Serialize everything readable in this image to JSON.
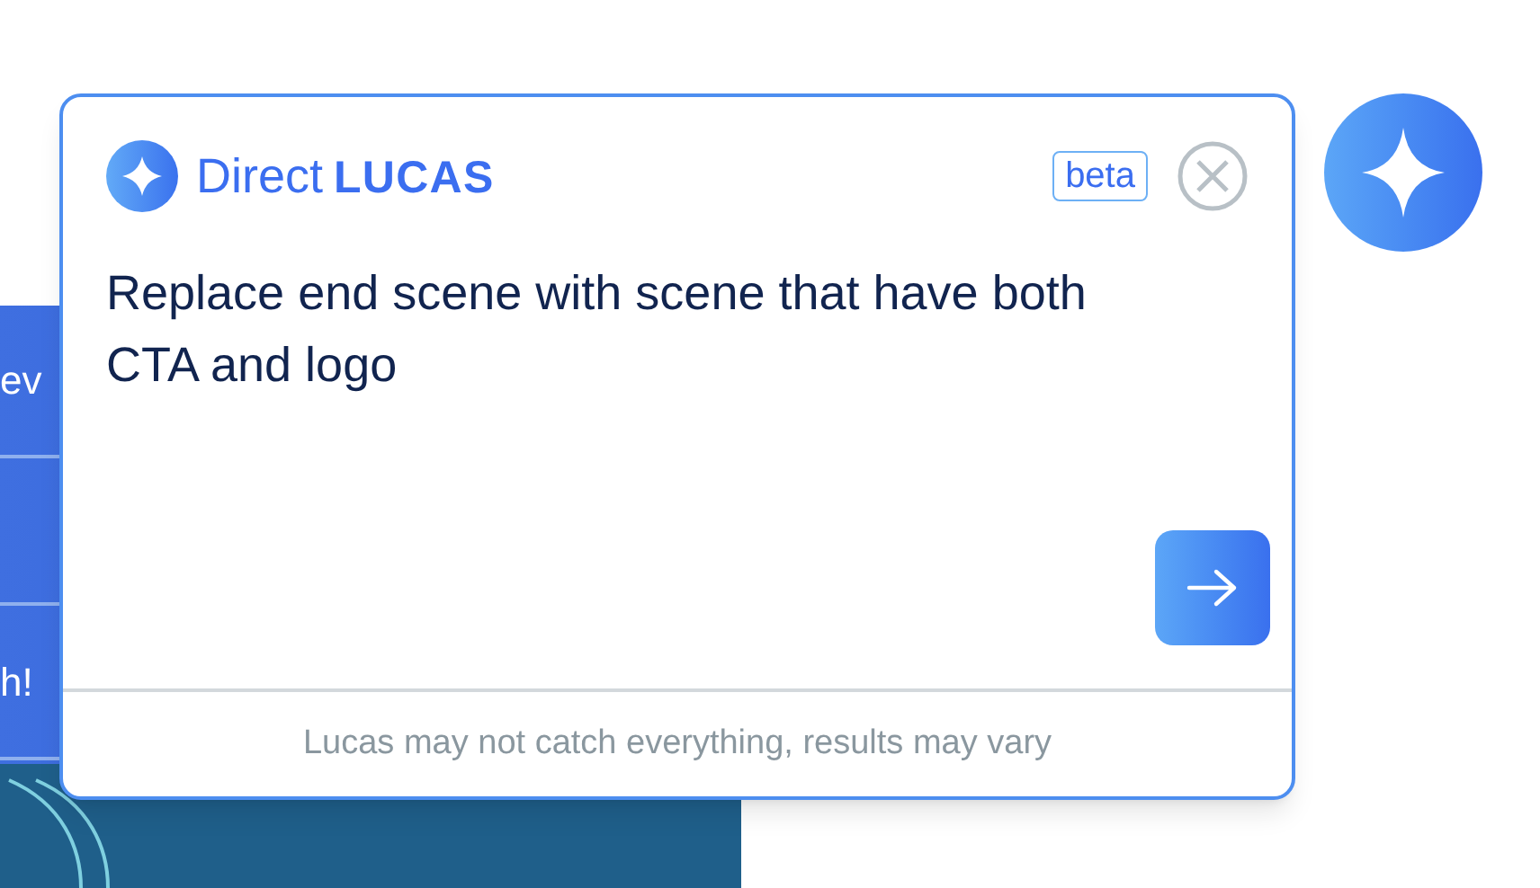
{
  "background_panel": {
    "fragments": [
      "ev",
      "h!"
    ]
  },
  "assistant": {
    "brand_prefix": "Direct",
    "brand_name": "LUCAS",
    "badge": "beta",
    "prompt_value": "Replace end scene with scene that have both CTA and logo",
    "disclaimer": "Lucas may not catch everything, results may vary"
  }
}
